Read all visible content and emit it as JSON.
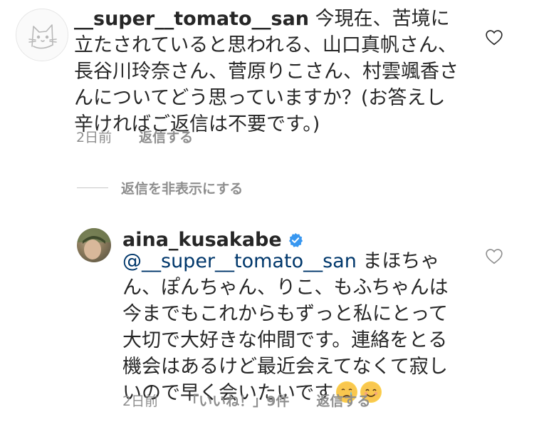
{
  "comment1": {
    "username": "__super__tomato__san",
    "text": "今現在、苦境に立たされていると思われる、山口真帆さん、長谷川玲奈さん、菅原りこさん、村雲颯香さんについてどう思っていますか？(お答えし辛ければご返信は不要です。)",
    "time": "2日前",
    "reply_label": "返信する",
    "avatar_icon": "cat-avatar-icon"
  },
  "hide_replies": {
    "label": "返信を非表示にする"
  },
  "reply1": {
    "username": "aina_kusakabe",
    "mention": "@__super__tomato__san",
    "text": "まほちゃん、ぽんちゃん、りこ、もふちゃんは今までもこれからもずっと私にとって大切で大好きな仲間です。連絡をとる機会はあるけど最近会えてなくて寂しいので早く会いたいです",
    "time": "2日前",
    "likes": "「いいね！」9件",
    "reply_label": "返信する",
    "verified_color": "#3897f0"
  },
  "colors": {
    "text": "#262626",
    "meta": "#8e8e8e",
    "mention": "#00376b",
    "divider": "#c7c7c7"
  }
}
